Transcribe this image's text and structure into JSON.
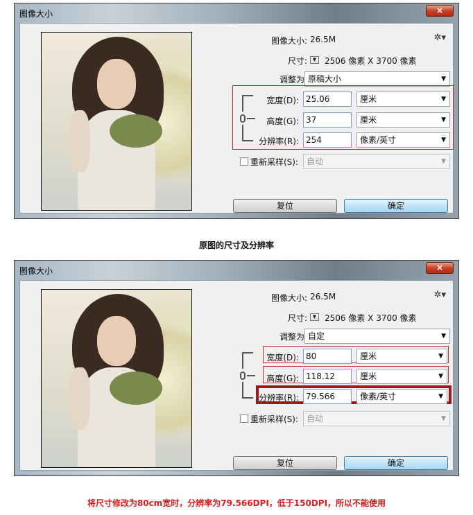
{
  "dialog1": {
    "title": "图像大小",
    "close": "×",
    "image_size_label": "图像大小:",
    "image_size_value": "26.5M",
    "dimensions_label": "尺寸:",
    "dimensions_value": "2506 像素  X  3700 像素",
    "fit_to_label": "调整为:",
    "fit_to_value": "原稿大小",
    "width_label": "宽度(D):",
    "width_value": "25.06",
    "width_unit": "厘米",
    "height_label": "高度(G):",
    "height_value": "37",
    "height_unit": "厘米",
    "resolution_label": "分辨率(R):",
    "resolution_value": "254",
    "resolution_unit": "像素/英寸",
    "resample_label": "重新采样(S):",
    "resample_value": "自动",
    "reset_button": "复位",
    "ok_button": "确定"
  },
  "caption1": "原图的尺寸及分辨率",
  "dialog2": {
    "title": "图像大小",
    "close": "×",
    "image_size_label": "图像大小:",
    "image_size_value": "26.5M",
    "dimensions_label": "尺寸:",
    "dimensions_value": "2506 像素  X  3700 像素",
    "fit_to_label": "调整为:",
    "fit_to_value": "自定",
    "width_label": "宽度(D):",
    "width_value": "80",
    "width_unit": "厘米",
    "height_label": "高度(G):",
    "height_value": "118.12",
    "height_unit": "厘米",
    "resolution_label": "分辨率(R):",
    "resolution_value": "79.566",
    "resolution_unit": "像素/英寸",
    "resample_label": "重新采样(S):",
    "resample_value": "自动",
    "reset_button": "复位",
    "ok_button": "确定"
  },
  "caption2": "将尺寸修改为80cm宽时，分辨率为79.566DPI，低于150DPI，所以不能使用",
  "icons": {
    "gear": "gear-icon",
    "dropdown": "chevron-down-icon",
    "link": "chain-link-icon",
    "close": "close-icon"
  },
  "colors": {
    "highlight": "#c0262d",
    "caption_warning": "#d61c1c",
    "ok_button": "#a7d7f4"
  }
}
